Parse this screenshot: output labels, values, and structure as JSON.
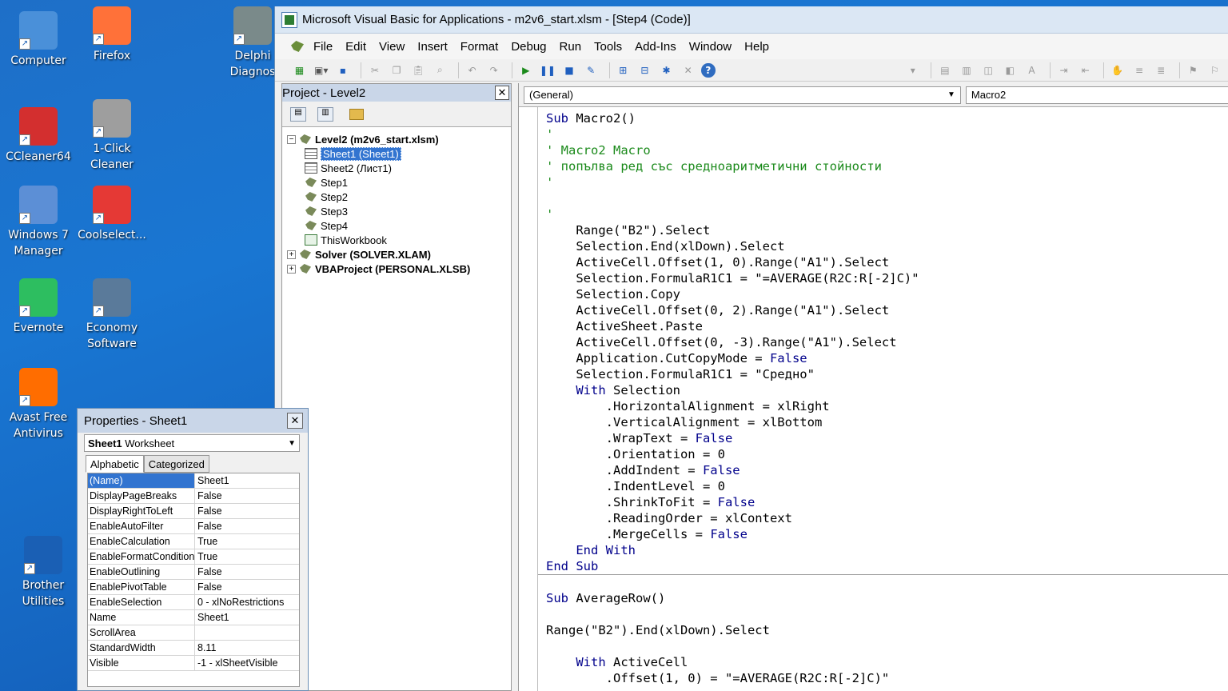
{
  "desktop": {
    "icons": [
      {
        "label": "Computer",
        "color": "#4a90d9"
      },
      {
        "label": "Firefox",
        "color": "#ff7139"
      },
      {
        "label": "Delphi Diagnos",
        "color": "#7a8a8a"
      },
      {
        "label": "CCleaner64",
        "color": "#d32f2f"
      },
      {
        "label": "1-Click Cleaner",
        "color": "#9e9e9e"
      },
      {
        "label": "Windows 7 Manager",
        "color": "#5c8fd6"
      },
      {
        "label": "Coolselect...",
        "color": "#e53935"
      },
      {
        "label": "Evernote",
        "color": "#2dbe60"
      },
      {
        "label": "Economy Software",
        "color": "#5a7a9a"
      },
      {
        "label": "Avast Free Antivirus",
        "color": "#ff6d00"
      },
      {
        "label": "Brother Utilities",
        "color": "#1a5fb4"
      }
    ]
  },
  "vba": {
    "title": "Microsoft Visual Basic for Applications - m2v6_start.xlsm - [Step4 (Code)]",
    "menu": [
      "File",
      "Edit",
      "View",
      "Insert",
      "Format",
      "Debug",
      "Run",
      "Tools",
      "Add-Ins",
      "Window",
      "Help"
    ]
  },
  "project": {
    "title": "Project - Level2",
    "close": "✕",
    "tree": [
      {
        "label": "Level2 (m2v6_start.xlsm)",
        "type": "proj",
        "bold": true,
        "expander": "−",
        "indent": 0
      },
      {
        "label": "Sheet1 (Sheet1)",
        "type": "sheet",
        "selected": true,
        "indent": 1
      },
      {
        "label": "Sheet2 (Лист1)",
        "type": "sheet",
        "indent": 1
      },
      {
        "label": "Step1",
        "type": "mod",
        "indent": 1
      },
      {
        "label": "Step2",
        "type": "mod",
        "indent": 1
      },
      {
        "label": "Step3",
        "type": "mod",
        "indent": 1
      },
      {
        "label": "Step4",
        "type": "mod",
        "indent": 1
      },
      {
        "label": "ThisWorkbook",
        "type": "wb",
        "indent": 1
      },
      {
        "label": "Solver (SOLVER.XLAM)",
        "type": "proj",
        "bold": true,
        "expander": "+",
        "indent": 0
      },
      {
        "label": "VBAProject (PERSONAL.XLSB)",
        "type": "proj",
        "bold": true,
        "expander": "+",
        "indent": 0
      }
    ]
  },
  "code": {
    "object_dropdown": "(General)",
    "proc_dropdown": "Macro2",
    "lines": [
      [
        {
          "t": "Sub ",
          "c": "kw"
        },
        {
          "t": "Macro2()",
          "c": "plain"
        }
      ],
      [
        {
          "t": "'",
          "c": "cm"
        }
      ],
      [
        {
          "t": "' Macro2 Macro",
          "c": "cm"
        }
      ],
      [
        {
          "t": "' попълва ред със средноаритметични стойности",
          "c": "cm"
        }
      ],
      [
        {
          "t": "'",
          "c": "cm"
        }
      ],
      [],
      [
        {
          "t": "'",
          "c": "cm"
        }
      ],
      [
        {
          "t": "    Range(\"B2\").Select",
          "c": "plain"
        }
      ],
      [
        {
          "t": "    Selection.End(xlDown).Select",
          "c": "plain"
        }
      ],
      [
        {
          "t": "    ActiveCell.Offset(1, 0).Range(\"A1\").Select",
          "c": "plain"
        }
      ],
      [
        {
          "t": "    Selection.FormulaR1C1 = \"=AVERAGE(R2C:R[-2]C)\"",
          "c": "plain"
        }
      ],
      [
        {
          "t": "    Selection.Copy",
          "c": "plain"
        }
      ],
      [
        {
          "t": "    ActiveCell.Offset(0, 2).Range(\"A1\").Select",
          "c": "plain"
        }
      ],
      [
        {
          "t": "    ActiveSheet.Paste",
          "c": "plain"
        }
      ],
      [
        {
          "t": "    ActiveCell.Offset(0, -3).Range(\"A1\").Select",
          "c": "plain"
        }
      ],
      [
        {
          "t": "    Application.CutCopyMode = ",
          "c": "plain"
        },
        {
          "t": "False",
          "c": "kw"
        }
      ],
      [
        {
          "t": "    Selection.FormulaR1C1 = \"Средно\"",
          "c": "plain"
        }
      ],
      [
        {
          "t": "    With ",
          "c": "kw"
        },
        {
          "t": "Selection",
          "c": "plain"
        }
      ],
      [
        {
          "t": "        .HorizontalAlignment = xlRight",
          "c": "plain"
        }
      ],
      [
        {
          "t": "        .VerticalAlignment = xlBottom",
          "c": "plain"
        }
      ],
      [
        {
          "t": "        .WrapText = ",
          "c": "plain"
        },
        {
          "t": "False",
          "c": "kw"
        }
      ],
      [
        {
          "t": "        .Orientation = 0",
          "c": "plain"
        }
      ],
      [
        {
          "t": "        .AddIndent = ",
          "c": "plain"
        },
        {
          "t": "False",
          "c": "kw"
        }
      ],
      [
        {
          "t": "        .IndentLevel = 0",
          "c": "plain"
        }
      ],
      [
        {
          "t": "        .ShrinkToFit = ",
          "c": "plain"
        },
        {
          "t": "False",
          "c": "kw"
        }
      ],
      [
        {
          "t": "        .ReadingOrder = xlContext",
          "c": "plain"
        }
      ],
      [
        {
          "t": "        .MergeCells = ",
          "c": "plain"
        },
        {
          "t": "False",
          "c": "kw"
        }
      ],
      [
        {
          "t": "    End With",
          "c": "kw"
        }
      ],
      [
        {
          "t": "End Sub",
          "c": "kw"
        }
      ],
      [
        "SEP"
      ],
      [
        {
          "t": "Sub ",
          "c": "kw"
        },
        {
          "t": "AverageRow()",
          "c": "plain"
        }
      ],
      [],
      [
        {
          "t": "Range(\"B2\").End(xlDown).Select",
          "c": "plain"
        }
      ],
      [],
      [
        {
          "t": "    With ",
          "c": "kw"
        },
        {
          "t": "ActiveCell",
          "c": "plain"
        }
      ],
      [
        {
          "t": "        .Offset(1, 0) = \"=AVERAGE(R2C:R[-2]C)\"",
          "c": "plain"
        }
      ]
    ]
  },
  "properties": {
    "title": "Properties - Sheet1",
    "close": "✕",
    "object_name": "Sheet1",
    "object_type": "Worksheet",
    "tabs": [
      "Alphabetic",
      "Categorized"
    ],
    "rows": [
      {
        "k": "(Name)",
        "v": "Sheet1",
        "selected": true
      },
      {
        "k": "DisplayPageBreaks",
        "v": "False"
      },
      {
        "k": "DisplayRightToLeft",
        "v": "False"
      },
      {
        "k": "EnableAutoFilter",
        "v": "False"
      },
      {
        "k": "EnableCalculation",
        "v": "True"
      },
      {
        "k": "EnableFormatConditionsCalculation",
        "v": "True"
      },
      {
        "k": "EnableOutlining",
        "v": "False"
      },
      {
        "k": "EnablePivotTable",
        "v": "False"
      },
      {
        "k": "EnableSelection",
        "v": "0 - xlNoRestrictions"
      },
      {
        "k": "Name",
        "v": "Sheet1"
      },
      {
        "k": "ScrollArea",
        "v": ""
      },
      {
        "k": "StandardWidth",
        "v": "8.11"
      },
      {
        "k": "Visible",
        "v": "-1 - xlSheetVisible"
      }
    ]
  }
}
